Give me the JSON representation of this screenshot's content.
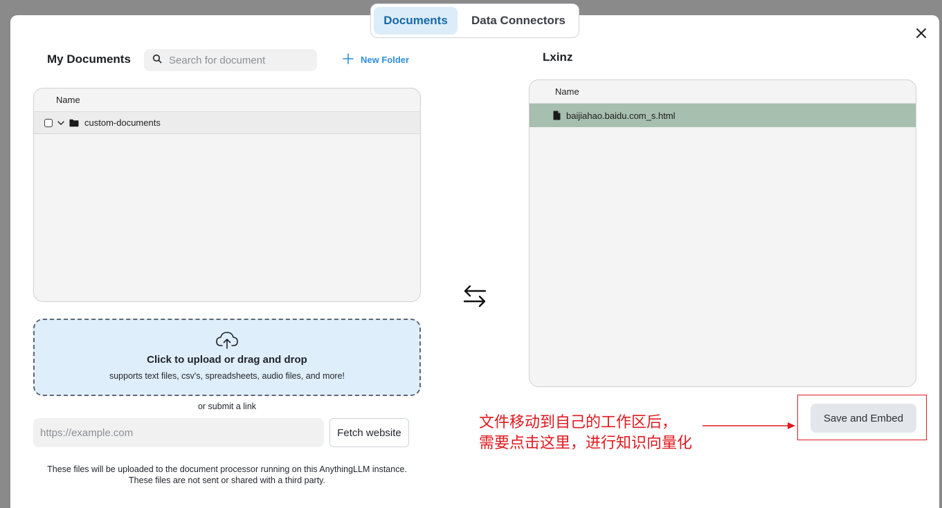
{
  "tabs": [
    {
      "label": "Documents",
      "active": true
    },
    {
      "label": "Data Connectors",
      "active": false
    }
  ],
  "icons": {
    "close": "close-icon",
    "search": "search-icon",
    "plus": "plus-icon",
    "chevron": "chevron-down-icon",
    "folder": "folder-icon",
    "file": "file-icon",
    "upload": "cloud-upload-icon",
    "swap": "swap-arrows-icon"
  },
  "my_documents": {
    "title": "My Documents",
    "search_placeholder": "Search for document",
    "new_folder_label": "New Folder",
    "column_name": "Name",
    "folders": [
      {
        "name": "custom-documents",
        "checked": false
      }
    ]
  },
  "upload": {
    "title": "Click to upload or drag and drop",
    "subtitle": "supports text files, csv's, spreadsheets, audio files, and more!",
    "or_link": "or submit a link",
    "url_placeholder": "https://example.com",
    "fetch_label": "Fetch website",
    "disclaimer_line1": "These files will be uploaded to the document processor running on this AnythingLLM instance.",
    "disclaimer_line2": "These files are not sent or shared with a third party."
  },
  "workspace": {
    "title": "Lxinz",
    "column_name": "Name",
    "files": [
      {
        "name": "baijiahao.baidu.com_s.html"
      }
    ],
    "save_label": "Save and Embed"
  },
  "annotation": {
    "line1": "文件移动到自己的工作区后，",
    "line2": "需要点击这里，进行知识向量化",
    "color": "#e0191f"
  },
  "colors": {
    "accent": "#2b8ddd",
    "active_tab_bg": "#dcecf9",
    "selected_file_bg": "#a7bfaf",
    "upload_bg": "#dfeefb"
  }
}
